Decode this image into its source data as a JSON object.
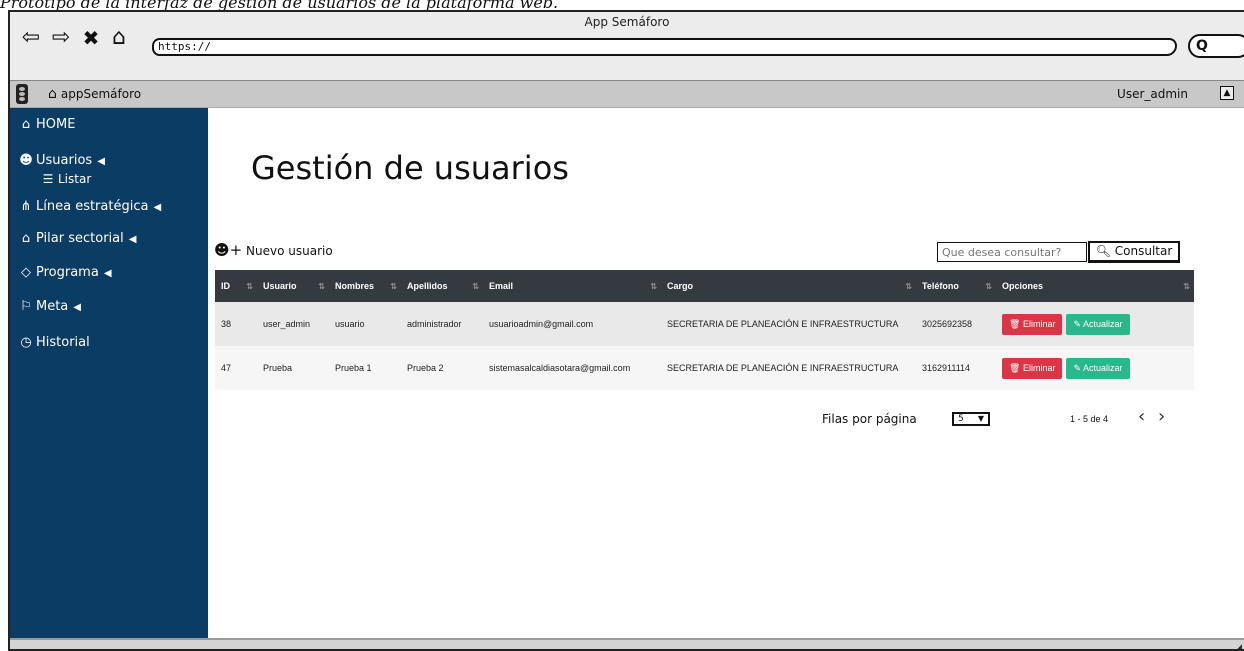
{
  "caption": "Prototipo de la interfaz de gestión de usuarios de la plataforma web.",
  "browser": {
    "title": "App Semáforo",
    "url": "https://",
    "icons": [
      "back-arrow-icon",
      "forward-arrow-icon",
      "close-icon",
      "home-icon",
      "search-icon"
    ]
  },
  "appbar": {
    "brand": "appSemáforo",
    "user": "User_admin"
  },
  "sidebar": {
    "items": [
      {
        "label": "HOME",
        "icon": "home-icon"
      },
      {
        "label": "Usuarios",
        "icon": "add-user-icon",
        "sub": "Listar"
      },
      {
        "label": "Línea estratégica",
        "icon": "sitemap-icon"
      },
      {
        "label": "Pilar sectorial",
        "icon": "institution-icon"
      },
      {
        "label": "Programa",
        "icon": "cube-icon"
      },
      {
        "label": "Meta",
        "icon": "flag-icon"
      },
      {
        "label": "Historial",
        "icon": "clock-icon"
      }
    ]
  },
  "main": {
    "title": "Gestión de usuarios",
    "new_user": "Nuevo usuario",
    "search_placeholder": "Que desea consultar?",
    "search_button": "Consultar"
  },
  "table": {
    "headers": [
      "ID",
      "Usuario",
      "Nombres",
      "Apellidos",
      "Email",
      "Cargo",
      "Teléfono",
      "Opciones"
    ],
    "rows": [
      {
        "id": "38",
        "usuario": "user_admin",
        "nombres": "usuario",
        "apellidos": "administrador",
        "email": "usuarioadmin@gmail.com",
        "cargo": "SECRETARIA DE PLANEACIÓN E INFRAESTRUCTURA",
        "telefono": "3025692358"
      },
      {
        "id": "47",
        "usuario": "Prueba",
        "nombres": "Prueba 1",
        "apellidos": "Prueba 2",
        "email": "sistemasalcaldiasotara@gmail.com",
        "cargo": "SECRETARIA DE PLANEACIÓN E INFRAESTRUCTURA",
        "telefono": "3162911114"
      }
    ],
    "delete_label": "Eliminar",
    "update_label": "Actualizar"
  },
  "pager": {
    "rows_label": "Filas por página",
    "rows_value": "5",
    "range": "1 - 5 de 4"
  },
  "colors": {
    "sidebar": "#0b3c63",
    "table_header": "#343a40",
    "delete": "#dc3545",
    "update": "#28b88a"
  }
}
